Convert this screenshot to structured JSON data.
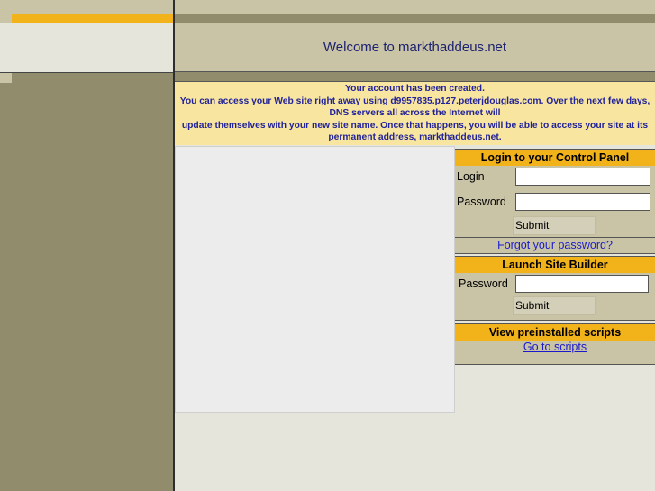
{
  "header": {
    "welcome": "Welcome to markthaddeus.net"
  },
  "notice": {
    "lines": [
      "Your account has been created.",
      "You can access your Web site right away using d9957835.p127.peterjdouglas.com. Over the next few days,",
      "DNS servers all across the Internet will",
      "update themselves with your new site name. Once that happens, you will be able to access your site at its",
      "permanent address, markthaddeus.net."
    ]
  },
  "login_panel": {
    "title": "Login to your Control Panel",
    "login_label": "Login",
    "login_value": "",
    "password_label": "Password",
    "password_value": "",
    "submit_label": "Submit",
    "forgot_link": "Forgot your password?"
  },
  "builder_panel": {
    "title": "Launch Site Builder",
    "password_label": "Password",
    "password_value": "",
    "submit_label": "Submit"
  },
  "scripts_panel": {
    "title": "View preinstalled scripts",
    "link": "Go to scripts"
  },
  "colors": {
    "accent_orange": "#f2b21a",
    "tan": "#cac4a6",
    "olive": "#908c6c",
    "notice_bg": "#f7e5a0",
    "title_blue": "#1d2370"
  }
}
